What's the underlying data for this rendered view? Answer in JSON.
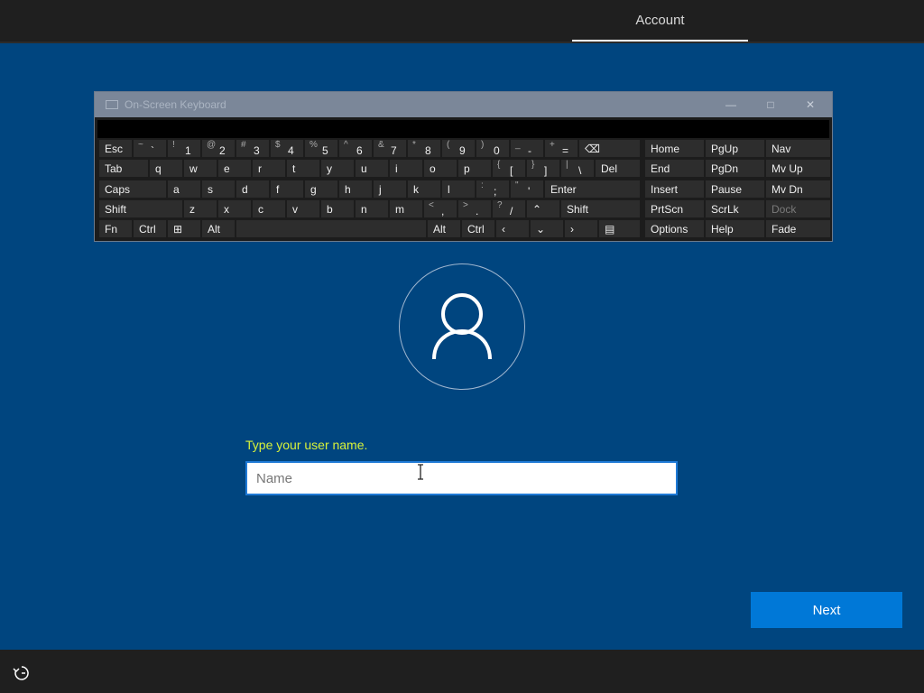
{
  "header": {
    "tab_label": "Account"
  },
  "osk": {
    "title": "On-Screen Keyboard",
    "controls": {
      "minimize": "—",
      "maximize": "□",
      "close": "✕"
    },
    "rows": [
      [
        {
          "n": "esc",
          "l": "Esc"
        },
        {
          "n": "tilde",
          "s": "~",
          "l": "`"
        },
        {
          "n": "1",
          "s": "!",
          "l": "1"
        },
        {
          "n": "2",
          "s": "@",
          "l": "2"
        },
        {
          "n": "3",
          "s": "#",
          "l": "3"
        },
        {
          "n": "4",
          "s": "$",
          "l": "4"
        },
        {
          "n": "5",
          "s": "%",
          "l": "5"
        },
        {
          "n": "6",
          "s": "^",
          "l": "6"
        },
        {
          "n": "7",
          "s": "&",
          "l": "7"
        },
        {
          "n": "8",
          "s": "*",
          "l": "8"
        },
        {
          "n": "9",
          "s": "(",
          "l": "9"
        },
        {
          "n": "0",
          "s": ")",
          "l": "0"
        },
        {
          "n": "minus",
          "s": "_",
          "l": "-"
        },
        {
          "n": "equals",
          "s": "+",
          "l": "="
        },
        {
          "n": "backspace",
          "l": "⌫"
        }
      ],
      [
        {
          "n": "tab",
          "l": "Tab"
        },
        {
          "n": "q",
          "l": "q"
        },
        {
          "n": "w",
          "l": "w"
        },
        {
          "n": "e",
          "l": "e"
        },
        {
          "n": "r",
          "l": "r"
        },
        {
          "n": "t",
          "l": "t"
        },
        {
          "n": "y",
          "l": "y"
        },
        {
          "n": "u",
          "l": "u"
        },
        {
          "n": "i",
          "l": "i"
        },
        {
          "n": "o",
          "l": "o"
        },
        {
          "n": "p",
          "l": "p"
        },
        {
          "n": "lbracket",
          "s": "{",
          "l": "["
        },
        {
          "n": "rbracket",
          "s": "}",
          "l": "]"
        },
        {
          "n": "backslash",
          "s": "|",
          "l": "\\"
        },
        {
          "n": "del",
          "l": "Del"
        }
      ],
      [
        {
          "n": "caps",
          "l": "Caps"
        },
        {
          "n": "a",
          "l": "a"
        },
        {
          "n": "s",
          "l": "s"
        },
        {
          "n": "d",
          "l": "d"
        },
        {
          "n": "f",
          "l": "f"
        },
        {
          "n": "g",
          "l": "g"
        },
        {
          "n": "h",
          "l": "h"
        },
        {
          "n": "j",
          "l": "j"
        },
        {
          "n": "k",
          "l": "k"
        },
        {
          "n": "l",
          "l": "l"
        },
        {
          "n": "semicolon",
          "s": ":",
          "l": ";"
        },
        {
          "n": "quote",
          "s": "\"",
          "l": "'"
        },
        {
          "n": "enter",
          "l": "Enter"
        }
      ],
      [
        {
          "n": "lshift",
          "l": "Shift"
        },
        {
          "n": "z",
          "l": "z"
        },
        {
          "n": "x",
          "l": "x"
        },
        {
          "n": "c",
          "l": "c"
        },
        {
          "n": "v",
          "l": "v"
        },
        {
          "n": "b",
          "l": "b"
        },
        {
          "n": "n",
          "l": "n"
        },
        {
          "n": "m",
          "l": "m"
        },
        {
          "n": "comma",
          "s": "<",
          "l": ","
        },
        {
          "n": "period",
          "s": ">",
          "l": "."
        },
        {
          "n": "slash",
          "s": "?",
          "l": "/"
        },
        {
          "n": "up",
          "l": "⌃"
        },
        {
          "n": "rshift",
          "l": "Shift"
        }
      ],
      [
        {
          "n": "fn",
          "l": "Fn"
        },
        {
          "n": "lctrl",
          "l": "Ctrl"
        },
        {
          "n": "win",
          "l": "⊞"
        },
        {
          "n": "lalt",
          "l": "Alt"
        },
        {
          "n": "space",
          "l": ""
        },
        {
          "n": "ralt",
          "l": "Alt"
        },
        {
          "n": "rctrl",
          "l": "Ctrl"
        },
        {
          "n": "left",
          "l": "‹"
        },
        {
          "n": "down",
          "l": "⌄"
        },
        {
          "n": "right",
          "l": "›"
        },
        {
          "n": "menu",
          "l": "▤"
        }
      ]
    ],
    "nav_keys": [
      [
        "Home",
        "PgUp",
        "Nav"
      ],
      [
        "End",
        "PgDn",
        "Mv Up"
      ],
      [
        "Insert",
        "Pause",
        "Mv Dn"
      ],
      [
        "PrtScn",
        "ScrLk",
        "Dock"
      ],
      [
        "Options",
        "Help",
        "Fade"
      ]
    ]
  },
  "form": {
    "prompt": "Type your user name.",
    "name_placeholder": "Name",
    "name_value": ""
  },
  "footer": {
    "next_label": "Next"
  },
  "icons": {
    "avatar": "user-icon",
    "ease_of_access": "ease-of-access-icon",
    "text_cursor": "text-cursor-icon"
  },
  "colors": {
    "background": "#00457f",
    "accent": "#0078d7",
    "prompt": "#d8f23a"
  }
}
